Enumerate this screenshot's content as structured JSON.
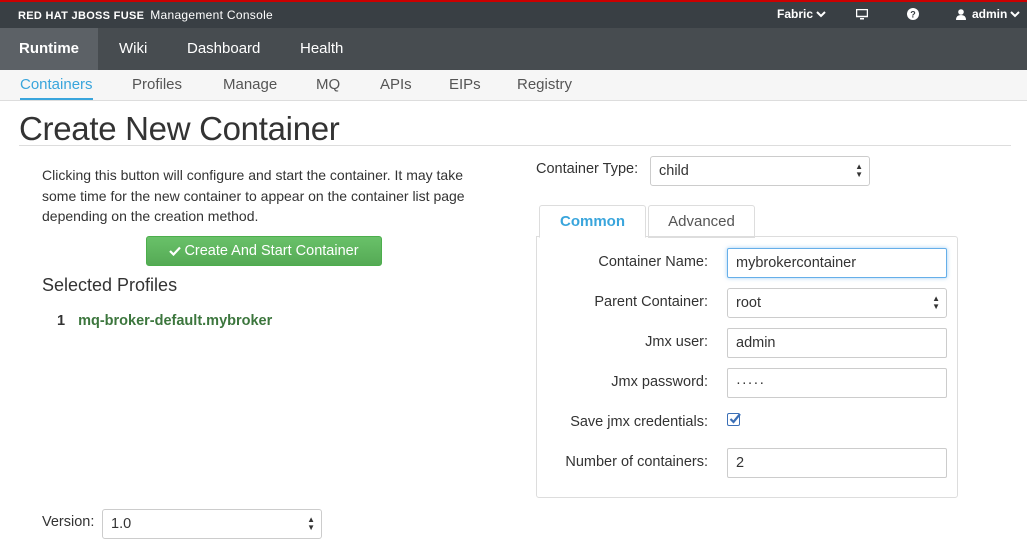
{
  "topbar": {
    "brand": "RED HAT JBOSS FUSE",
    "console": "Management Console",
    "fabric": "Fabric",
    "user": "admin"
  },
  "nav1": [
    "Runtime",
    "Wiki",
    "Dashboard",
    "Health"
  ],
  "nav2": [
    "Containers",
    "Profiles",
    "Manage",
    "MQ",
    "APIs",
    "EIPs",
    "Registry"
  ],
  "page": {
    "title": "Create New Container",
    "description": "Clicking this button will configure and start the container. It may take some time for the new container to appear on the container list page depending on the creation method.",
    "create_button": "Create And Start Container",
    "selected_profiles_title": "Selected Profiles",
    "profiles": [
      {
        "num": "1",
        "name": "mq-broker-default.mybroker"
      }
    ],
    "version_label": "Version:",
    "version_value": "1.0",
    "container_type_label": "Container Type:",
    "container_type_value": "child"
  },
  "tabs": [
    "Common",
    "Advanced"
  ],
  "form": {
    "container_name_label": "Container Name:",
    "container_name_value": "mybrokercontainer",
    "parent_container_label": "Parent Container:",
    "parent_container_value": "root",
    "jmx_user_label": "Jmx user:",
    "jmx_user_value": "admin",
    "jmx_password_label": "Jmx password:",
    "jmx_password_value": "·····",
    "save_jmx_label": "Save jmx credentials:",
    "save_jmx_checked": true,
    "num_containers_label": "Number of containers:",
    "num_containers_value": "2"
  },
  "colors": {
    "accent": "#39a5dc",
    "success": "#5cb85c",
    "profile_green": "#3c763d",
    "topbar": "#393f44"
  }
}
